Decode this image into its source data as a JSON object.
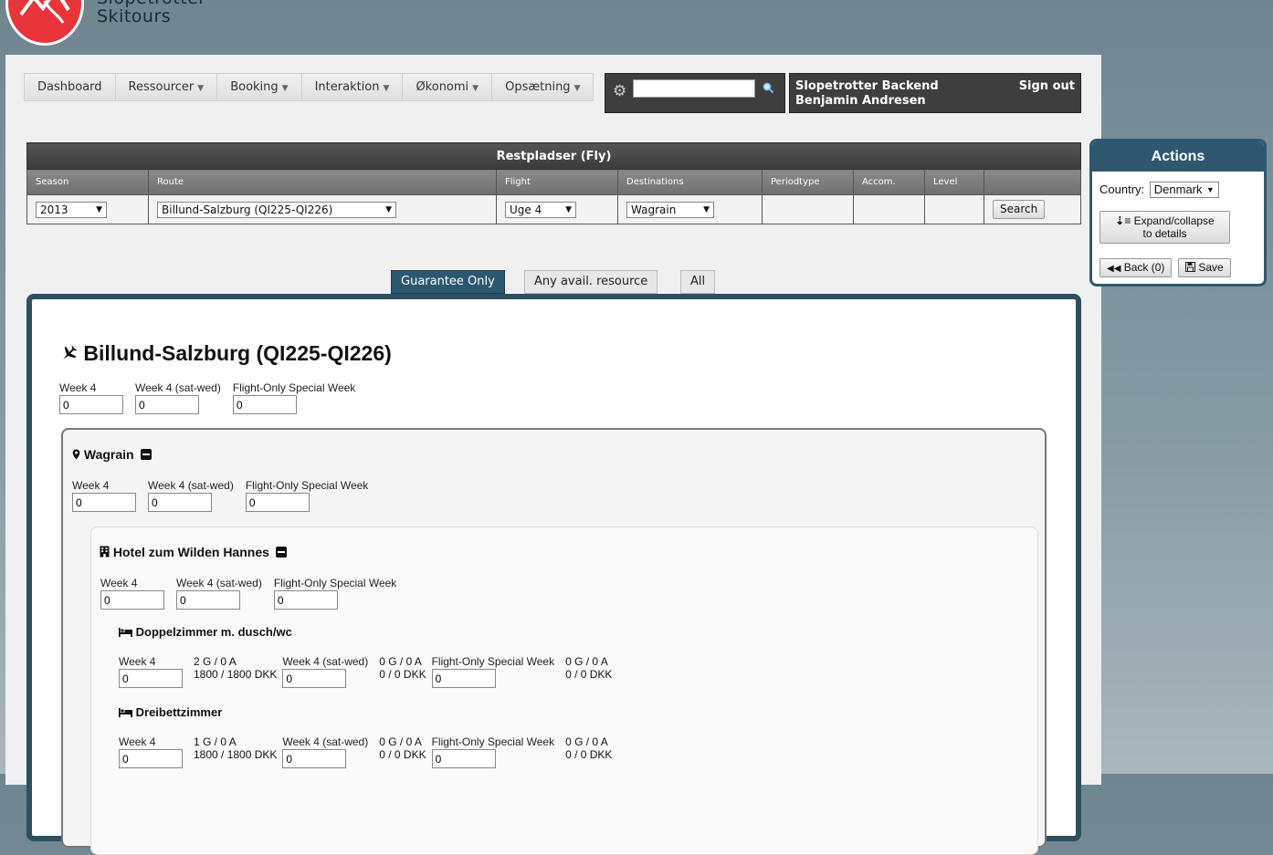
{
  "brand": {
    "line1": "Slopetrotter",
    "line2": "Skitours"
  },
  "nav": {
    "items": [
      {
        "label": "Dashboard",
        "dropdown": false
      },
      {
        "label": "Ressourcer",
        "dropdown": true
      },
      {
        "label": "Booking",
        "dropdown": true
      },
      {
        "label": "Interaktion",
        "dropdown": true
      },
      {
        "label": "Økonomi",
        "dropdown": true
      },
      {
        "label": "Opsætning",
        "dropdown": true
      }
    ]
  },
  "search": {
    "value": ""
  },
  "user": {
    "app_name": "Slopetrotter Backend",
    "name": "Benjamin Andresen",
    "signout": "Sign out"
  },
  "filter": {
    "title": "Restpladser (Fly)",
    "headers": [
      "Season",
      "Route",
      "Flight",
      "Destinations",
      "Periodtype",
      "Accom.",
      "Level",
      ""
    ],
    "season": "2013",
    "route": "Billund-Salzburg (QI225-QI226)",
    "flight": "Uge 4",
    "destination": "Wagrain",
    "search_button": "Search"
  },
  "tabs": [
    "Guarantee Only",
    "Any avail. resource",
    "All"
  ],
  "route": {
    "title": "Billund-Salzburg (QI225-QI226)",
    "weeks": [
      {
        "label": "Week 4",
        "value": "0"
      },
      {
        "label": "Week 4 (sat-wed)",
        "value": "0"
      },
      {
        "label": "Flight-Only Special Week",
        "value": "0"
      }
    ]
  },
  "destination": {
    "title": "Wagrain",
    "weeks": [
      {
        "label": "Week 4",
        "value": "0"
      },
      {
        "label": "Week 4 (sat-wed)",
        "value": "0"
      },
      {
        "label": "Flight-Only Special Week",
        "value": "0"
      }
    ]
  },
  "hotel": {
    "title": "Hotel zum Wilden Hannes",
    "weeks": [
      {
        "label": "Week 4",
        "value": "0"
      },
      {
        "label": "Week 4 (sat-wed)",
        "value": "0"
      },
      {
        "label": "Flight-Only Special Week",
        "value": "0"
      }
    ]
  },
  "rooms": [
    {
      "title": "Doppelzimmer m. dusch/wc",
      "weeks": [
        {
          "label": "Week 4",
          "value": "0",
          "avail1": "2 G / 0 A",
          "avail2": "1800 / 1800 DKK"
        },
        {
          "label": "Week 4 (sat-wed)",
          "value": "0",
          "avail1": "0 G / 0 A",
          "avail2": "0 / 0 DKK"
        },
        {
          "label": "Flight-Only Special Week",
          "value": "0",
          "avail1": "0 G / 0 A",
          "avail2": "0 / 0 DKK"
        }
      ]
    },
    {
      "title": "Dreibettzimmer",
      "weeks": [
        {
          "label": "Week 4",
          "value": "0",
          "avail1": "1 G / 0 A",
          "avail2": "1800 / 1800 DKK"
        },
        {
          "label": "Week 4 (sat-wed)",
          "value": "0",
          "avail1": "0 G / 0 A",
          "avail2": "0 / 0 DKK"
        },
        {
          "label": "Flight-Only Special Week",
          "value": "0",
          "avail1": "0 G / 0 A",
          "avail2": "0 / 0 DKK"
        }
      ]
    }
  ],
  "actions": {
    "title": "Actions",
    "country_label": "Country:",
    "country_value": "Denmark",
    "expand_line1": "Expand/collapse",
    "expand_line2": "to details",
    "back": "Back (0)",
    "save": "Save"
  },
  "colors": {
    "accent": "#2b5770",
    "brand_red": "#e8353b",
    "dark_bar": "#3e3e3e"
  }
}
